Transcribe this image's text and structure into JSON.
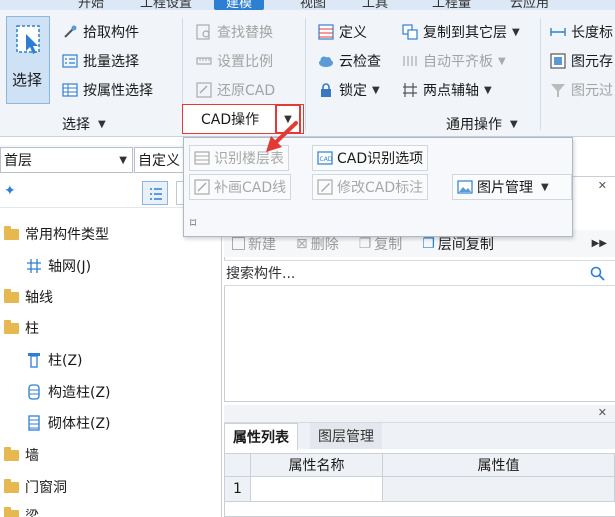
{
  "tabs": [
    "开始",
    "工程设置",
    "建模",
    "视图",
    "工具",
    "工程量",
    "云应用"
  ],
  "active_tab": "建模",
  "ribbon": {
    "select_group": {
      "select_label": "选择",
      "pick_label": "拾取构件",
      "batch_label": "批量选择",
      "attr_select_label": "按属性选择",
      "group_label": "选择"
    },
    "cad_group": {
      "find_replace": "查找替换",
      "set_scale": "设置比例",
      "restore_cad": "还原CAD",
      "group_label": "CAD操作"
    },
    "common_group": {
      "define": "定义",
      "cloud_check": "云检查",
      "lock": "锁定",
      "copy_to_layer": "复制到其它层",
      "auto_align": "自动平齐板",
      "two_point_axis": "两点辅轴",
      "length_mark": "长度标",
      "layer_exists": "图元存",
      "layer_filter": "图元过",
      "group_label": "通用操作"
    }
  },
  "cad_dropdown": {
    "identify_floor": "识别楼层表",
    "cad_identify_options": "CAD识别选项",
    "redraw_cad_line": "补画CAD线",
    "modify_cad_note": "修改CAD标注",
    "image_manage": "图片管理"
  },
  "floor_bar": {
    "floor_value": "首层",
    "custom_value": "自定义"
  },
  "tree": {
    "items": [
      {
        "label": "常用构件类型",
        "type": "folder"
      },
      {
        "label": "轴网(J)",
        "type": "child"
      },
      {
        "label": "轴线",
        "type": "folder"
      },
      {
        "label": "柱",
        "type": "folder"
      },
      {
        "label": "柱(Z)",
        "type": "child"
      },
      {
        "label": "构造柱(Z)",
        "type": "child"
      },
      {
        "label": "砌体柱(Z)",
        "type": "child"
      },
      {
        "label": "墙",
        "type": "folder"
      },
      {
        "label": "门窗洞",
        "type": "folder"
      },
      {
        "label": "梁",
        "type": "folder"
      }
    ]
  },
  "component_panel": {
    "new_label": "新建",
    "delete_label": "删除",
    "copy_label": "复制",
    "layer_copy_label": "层间复制",
    "search_placeholder": "搜索构件..."
  },
  "property_panel": {
    "tab_props": "属性列表",
    "tab_layers": "图层管理",
    "col_name": "属性名称",
    "col_value": "属性值",
    "row_1": "1"
  },
  "colors": {
    "accent": "#2d7fd4",
    "highlight_red": "#e53935",
    "folder": "#e7b84f"
  }
}
